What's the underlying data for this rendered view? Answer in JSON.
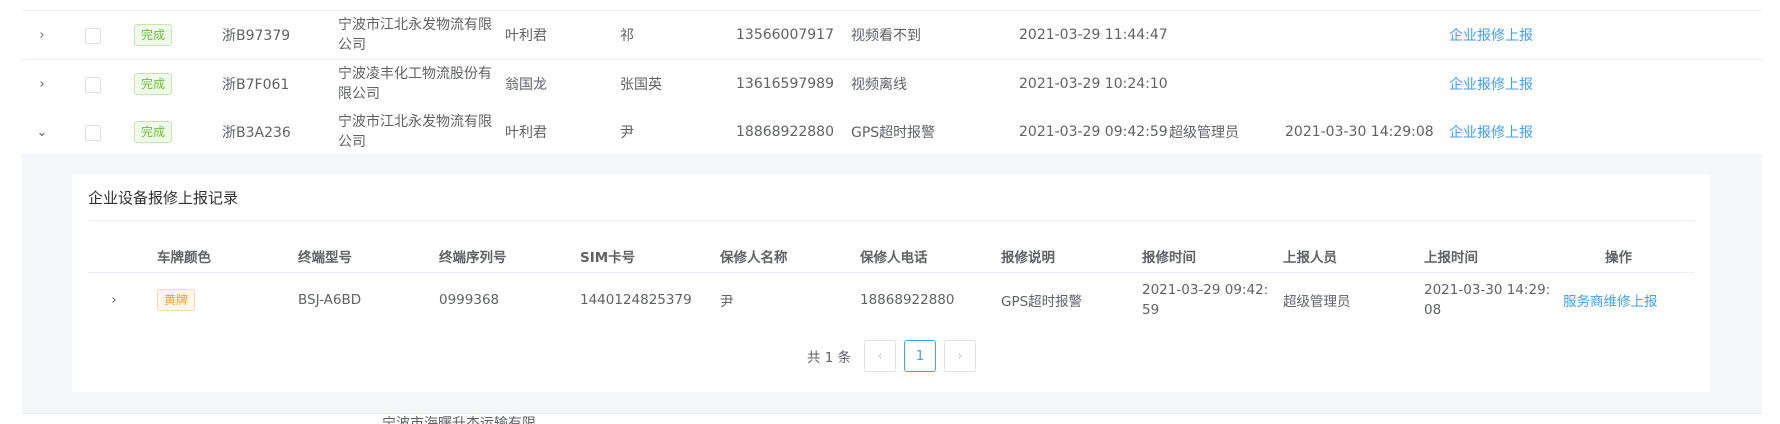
{
  "rows": [
    {
      "status": "完成",
      "plate": "浙B97379",
      "company": "宁波市江北永发物流有限公司",
      "person": "叶利君",
      "repairer": "祁",
      "phone": "13566007917",
      "desc": "视频看不到",
      "time": "2021-03-29 11:44:47",
      "reporter": "",
      "report_time": "",
      "action": "企业报修上报",
      "expand_icon": "chevron-right"
    },
    {
      "status": "完成",
      "plate": "浙B7F061",
      "company": "宁波凌丰化工物流股份有限公司",
      "person": "翁国龙",
      "repairer": "张国英",
      "phone": "13616597989",
      "desc": "视频离线",
      "time": "2021-03-29 10:24:10",
      "reporter": "",
      "report_time": "",
      "action": "企业报修上报",
      "expand_icon": "chevron-right"
    },
    {
      "status": "完成",
      "plate": "浙B3A236",
      "company": "宁波市江北永发物流有限公司",
      "person": "叶利君",
      "repairer": "尹",
      "phone": "18868922880",
      "desc": "GPS超时报警",
      "time": "2021-03-29 09:42:59",
      "reporter": "超级管理员",
      "report_time": "2021-03-30 14:29:08",
      "action": "企业报修上报",
      "expand_icon": "chevron-down"
    }
  ],
  "inner": {
    "title": "企业设备报修上报记录",
    "headers": [
      "车牌颜色",
      "终端型号",
      "终端序列号",
      "SIM卡号",
      "保修人名称",
      "保修人电话",
      "报修说明",
      "报修时间",
      "上报人员",
      "上报时间",
      "操作"
    ],
    "row": {
      "color": "黄牌",
      "model": "BSJ-A6BD",
      "serial": "0999368",
      "sim": "1440124825379",
      "name": "尹",
      "phone": "18868922880",
      "desc": "GPS超时报警",
      "time": "2021-03-29 09:42:59",
      "reporter": "超级管理员",
      "report_time": "2021-03-30 14:29:08",
      "action": "服务商维修上报"
    },
    "pager": {
      "total": "共 1 条",
      "current": "1",
      "prev_icon": "chevron-left",
      "next_icon": "chevron-right"
    }
  },
  "next_row_partial": "宁波市海曙升杰运输有限",
  "colors": {
    "link": "#409eff",
    "success": "#67c23a",
    "warning": "#e6a23c"
  }
}
